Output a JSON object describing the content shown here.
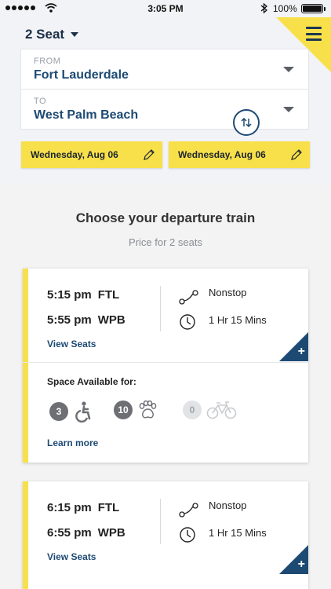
{
  "status_bar": {
    "time": "3:05 PM",
    "battery": "100%"
  },
  "header": {
    "seat_selector": "2 Seat",
    "from": {
      "label": "FROM",
      "value": "Fort Lauderdale"
    },
    "to": {
      "label": "TO",
      "value": "West Palm Beach"
    },
    "departure_date": "Wednesday, Aug 06",
    "return_date": "Wednesday, Aug 06"
  },
  "main": {
    "title": "Choose your departure train",
    "subtitle": "Price for 2 seats",
    "trains": [
      {
        "dep_time": "5:15 pm",
        "dep_station": "FTL",
        "arr_time": "5:55 pm",
        "arr_station": "WPB",
        "stops": "Nonstop",
        "duration": "1 Hr 15 Mins",
        "view_seats": "View Seats",
        "space_title": "Space Available for:",
        "amenities": [
          {
            "count": "3",
            "icon": "wheelchair-icon"
          },
          {
            "count": "10",
            "icon": "pet-paw-icon"
          },
          {
            "count": "0",
            "icon": "bicycle-icon"
          }
        ],
        "learn_more": "Learn more"
      },
      {
        "dep_time": "6:15 pm",
        "dep_station": "FTL",
        "arr_time": "6:55 pm",
        "arr_station": "WPB",
        "stops": "Nonstop",
        "duration": "1 Hr 15 Mins",
        "view_seats": "View Seats"
      }
    ]
  },
  "colors": {
    "accent_yellow": "#f8e04a",
    "navy": "#1d4a73",
    "dark_navy": "#1d3552"
  }
}
